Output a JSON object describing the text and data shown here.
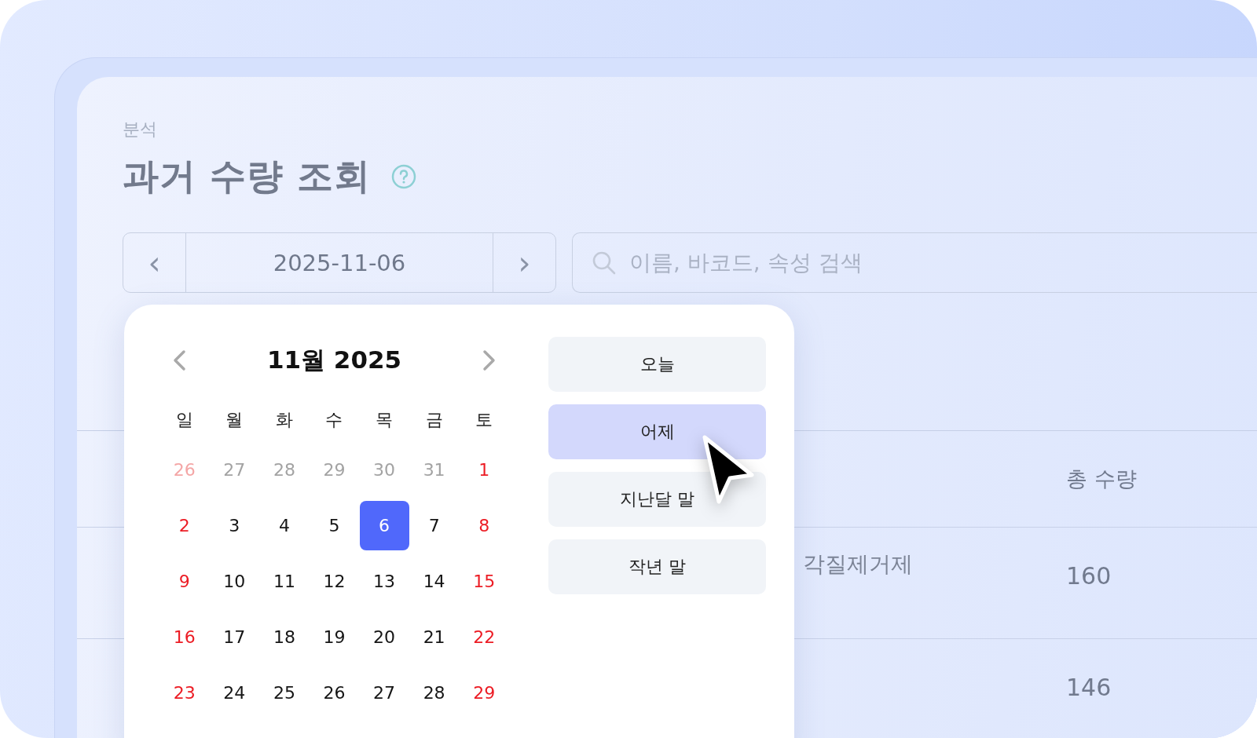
{
  "breadcrumb": "분석",
  "title": "과거 수량 조회",
  "date_nav": {
    "prev": "‹",
    "value": "2025-11-06",
    "next": "›"
  },
  "search": {
    "placeholder": "이름, 바코드, 속성 검색"
  },
  "table": {
    "columns": [
      "총 수량"
    ],
    "rows": [
      {
        "name": "각질제거제",
        "total": "160"
      },
      {
        "total": "146"
      }
    ]
  },
  "datepicker": {
    "month_title": "11월 2025",
    "weekdays": [
      "일",
      "월",
      "화",
      "수",
      "목",
      "금",
      "토"
    ],
    "weeks": [
      [
        {
          "day": "26",
          "outside": true,
          "selected": false
        },
        {
          "day": "27",
          "outside": true,
          "selected": false
        },
        {
          "day": "28",
          "outside": true,
          "selected": false
        },
        {
          "day": "29",
          "outside": true,
          "selected": false
        },
        {
          "day": "30",
          "outside": true,
          "selected": false
        },
        {
          "day": "31",
          "outside": true,
          "selected": false
        },
        {
          "day": "1",
          "outside": false,
          "selected": false
        }
      ],
      [
        {
          "day": "2",
          "outside": false,
          "selected": false
        },
        {
          "day": "3",
          "outside": false,
          "selected": false
        },
        {
          "day": "4",
          "outside": false,
          "selected": false
        },
        {
          "day": "5",
          "outside": false,
          "selected": false
        },
        {
          "day": "6",
          "outside": false,
          "selected": true
        },
        {
          "day": "7",
          "outside": false,
          "selected": false
        },
        {
          "day": "8",
          "outside": false,
          "selected": false
        }
      ],
      [
        {
          "day": "9",
          "outside": false,
          "selected": false
        },
        {
          "day": "10",
          "outside": false,
          "selected": false
        },
        {
          "day": "11",
          "outside": false,
          "selected": false
        },
        {
          "day": "12",
          "outside": false,
          "selected": false
        },
        {
          "day": "13",
          "outside": false,
          "selected": false
        },
        {
          "day": "14",
          "outside": false,
          "selected": false
        },
        {
          "day": "15",
          "outside": false,
          "selected": false
        }
      ],
      [
        {
          "day": "16",
          "outside": false,
          "selected": false
        },
        {
          "day": "17",
          "outside": false,
          "selected": false
        },
        {
          "day": "18",
          "outside": false,
          "selected": false
        },
        {
          "day": "19",
          "outside": false,
          "selected": false
        },
        {
          "day": "20",
          "outside": false,
          "selected": false
        },
        {
          "day": "21",
          "outside": false,
          "selected": false
        },
        {
          "day": "22",
          "outside": false,
          "selected": false
        }
      ],
      [
        {
          "day": "23",
          "outside": false,
          "selected": false
        },
        {
          "day": "24",
          "outside": false,
          "selected": false
        },
        {
          "day": "25",
          "outside": false,
          "selected": false
        },
        {
          "day": "26",
          "outside": false,
          "selected": false
        },
        {
          "day": "27",
          "outside": false,
          "selected": false
        },
        {
          "day": "28",
          "outside": false,
          "selected": false
        },
        {
          "day": "29",
          "outside": false,
          "selected": false
        }
      ]
    ],
    "shortcuts": [
      {
        "label": "오늘",
        "selected": false
      },
      {
        "label": "어제",
        "selected": true
      },
      {
        "label": "지난달 말",
        "selected": false
      },
      {
        "label": "작년 말",
        "selected": false
      }
    ]
  }
}
